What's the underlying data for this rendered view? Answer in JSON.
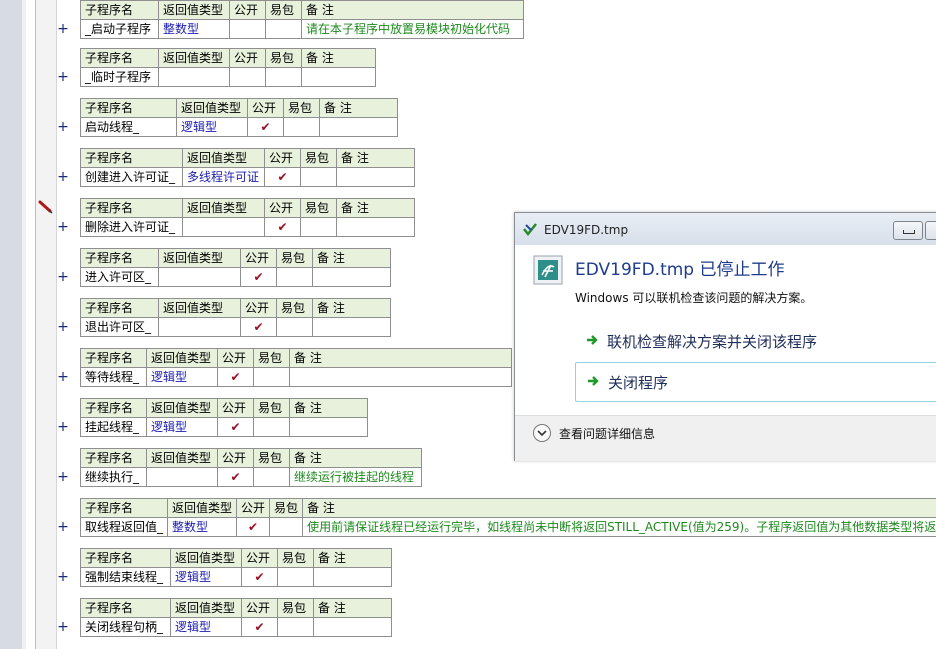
{
  "headers": [
    "子程序名",
    "返回值类型",
    "公开",
    "易包",
    "备 注"
  ],
  "check_glyph": "✔",
  "subroutines": [
    {
      "name": "_启动子程序",
      "ret": "整数型",
      "public": "",
      "easy": "",
      "note": "请在本子程序中放置易模块初始化代码"
    },
    {
      "name": "_临时子程序",
      "ret": "",
      "public": "",
      "easy": "",
      "note": ""
    },
    {
      "name": "启动线程_",
      "ret": "逻辑型",
      "public": "✔",
      "easy": "",
      "note": ""
    },
    {
      "name": "创建进入许可证_",
      "ret": "多线程许可证",
      "public": "✔",
      "easy": "",
      "note": ""
    },
    {
      "name": "删除进入许可证_",
      "ret": "",
      "public": "✔",
      "easy": "",
      "note": ""
    },
    {
      "name": "进入许可区_",
      "ret": "",
      "public": "✔",
      "easy": "",
      "note": ""
    },
    {
      "name": "退出许可区_",
      "ret": "",
      "public": "✔",
      "easy": "",
      "note": ""
    },
    {
      "name": "等待线程_",
      "ret": "逻辑型",
      "public": "✔",
      "easy": "",
      "note": ""
    },
    {
      "name": "挂起线程_",
      "ret": "逻辑型",
      "public": "✔",
      "easy": "",
      "note": ""
    },
    {
      "name": "继续执行_",
      "ret": "",
      "public": "✔",
      "easy": "",
      "note": "继续运行被挂起的线程"
    },
    {
      "name": "取线程返回值_",
      "ret": "整数型",
      "public": "✔",
      "easy": "",
      "note": "使用前请保证线程已经运行完毕，如线程尚未中断将返回STILL_ACTIVE(值为259)。子程序返回值为其他数据类型将返"
    },
    {
      "name": "强制结束线程_",
      "ret": "逻辑型",
      "public": "✔",
      "easy": "",
      "note": ""
    },
    {
      "name": "关闭线程句柄_",
      "ret": "逻辑型",
      "public": "✔",
      "easy": "",
      "note": ""
    }
  ],
  "expand_glyph": "+",
  "dialog": {
    "title": "EDV19FD.tmp",
    "heading": "EDV19FD.tmp 已停止工作",
    "description": "Windows 可以联机检查该问题的解决方案。",
    "option_online": "联机检查解决方案并关闭该程序",
    "option_close": "关闭程序",
    "details": "查看问题详细信息"
  },
  "icons": {
    "pencil": "pencil-icon",
    "app": "app-icon",
    "error": "program-error-icon",
    "arrow": "green-arrow-icon",
    "chevron": "chevron-down-icon"
  },
  "colors": {
    "header_bg": "#e8f1dc",
    "type_text": "#1b1bb0",
    "note_text": "#1e8a1e",
    "check": "#9a1020",
    "dialog_heading": "#1e3c8c"
  }
}
